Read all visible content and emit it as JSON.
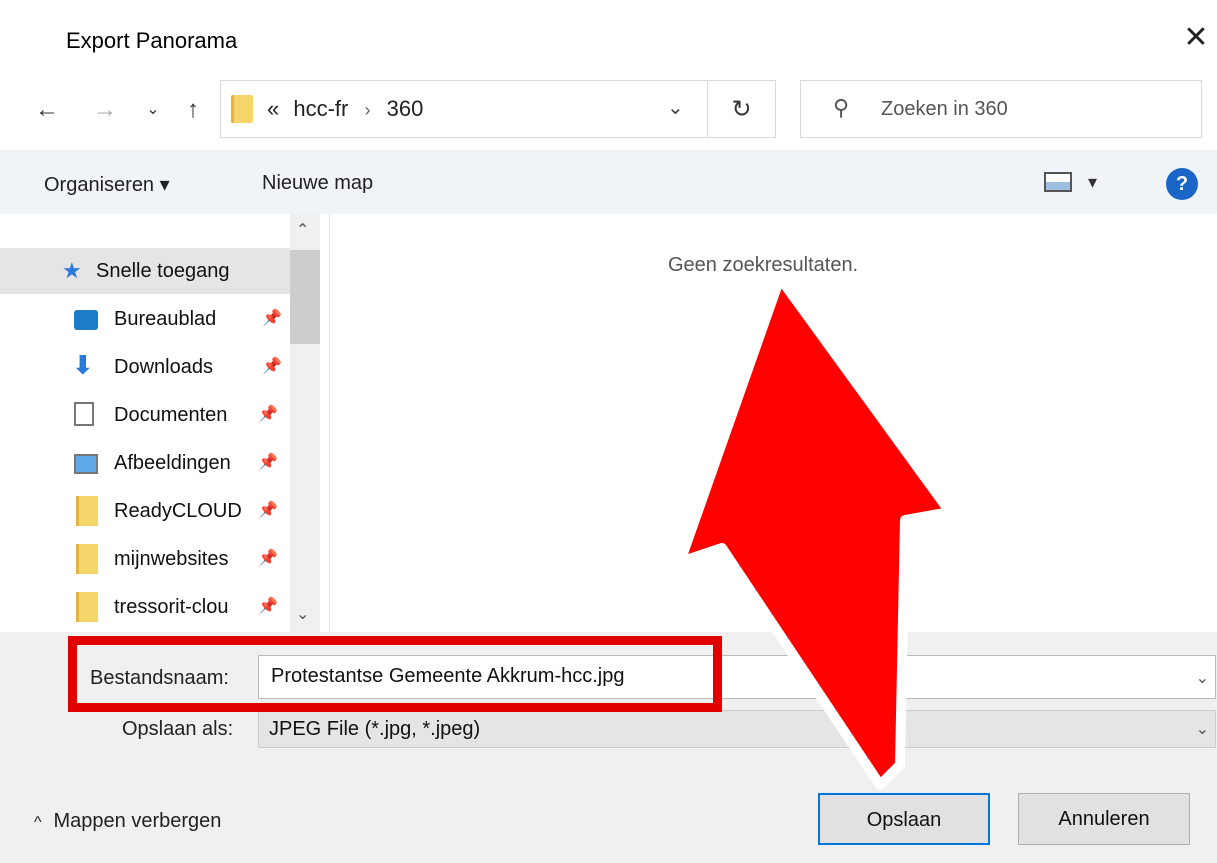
{
  "window": {
    "title": "Export Panorama"
  },
  "address": {
    "overflow": "«",
    "path": [
      "hcc-fr",
      "360"
    ]
  },
  "search": {
    "placeholder": "Zoeken in 360"
  },
  "toolbar": {
    "organize": "Organiseren ▾",
    "new_folder": "Nieuwe map",
    "help": "?"
  },
  "sidebar": {
    "items": [
      {
        "label": "Snelle toegang",
        "icon": "star-icon",
        "pinned": false
      },
      {
        "label": "Bureaublad",
        "icon": "desktop-icon",
        "pinned": true
      },
      {
        "label": "Downloads",
        "icon": "download-icon",
        "pinned": true
      },
      {
        "label": "Documenten",
        "icon": "document-icon",
        "pinned": true
      },
      {
        "label": "Afbeeldingen",
        "icon": "pictures-icon",
        "pinned": true
      },
      {
        "label": "ReadyCLOUD",
        "icon": "folder-icon",
        "pinned": true
      },
      {
        "label": "mijnwebsites",
        "icon": "folder-icon",
        "pinned": true
      },
      {
        "label": "tressorit-clou",
        "icon": "folder-icon",
        "pinned": true
      }
    ]
  },
  "content": {
    "empty_text": "Geen zoekresultaten."
  },
  "form": {
    "filename_label": "Bestandsnaam:",
    "filename_value": "Protestantse Gemeente Akkrum-hcc.jpg",
    "type_label": "Opslaan als:",
    "type_value": "JPEG File (*.jpg, *.jpeg)"
  },
  "footer": {
    "hide_folders": "Mappen verbergen",
    "save": "Opslaan",
    "cancel": "Annuleren"
  },
  "colors": {
    "accent": "#0078d7",
    "annotation": "#ff0000",
    "folder": "#f5d46a"
  }
}
